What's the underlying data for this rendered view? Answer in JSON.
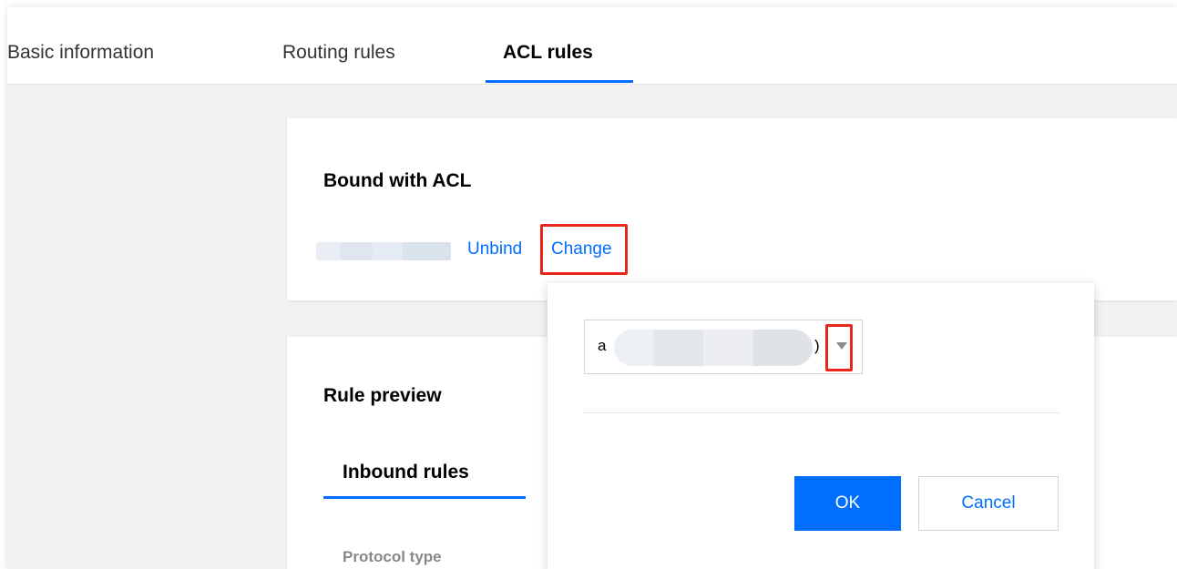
{
  "tabs": [
    {
      "label": "Basic information",
      "active": false
    },
    {
      "label": "Routing rules",
      "active": false
    },
    {
      "label": "ACL rules",
      "active": true
    }
  ],
  "bound_card": {
    "title": "Bound with ACL",
    "unbind_label": "Unbind",
    "change_label": "Change"
  },
  "rule_card": {
    "title": "Rule preview",
    "subtab_label": "Inbound rules",
    "field_label": "Protocol type"
  },
  "popover": {
    "select_prefix": "a",
    "select_suffix": ")",
    "ok_label": "OK",
    "cancel_label": "Cancel"
  },
  "colors": {
    "accent": "#006eff",
    "highlight": "#e8261b",
    "background": "#f2f2f2"
  },
  "icons": {
    "select_caret": "caret-down-icon"
  }
}
